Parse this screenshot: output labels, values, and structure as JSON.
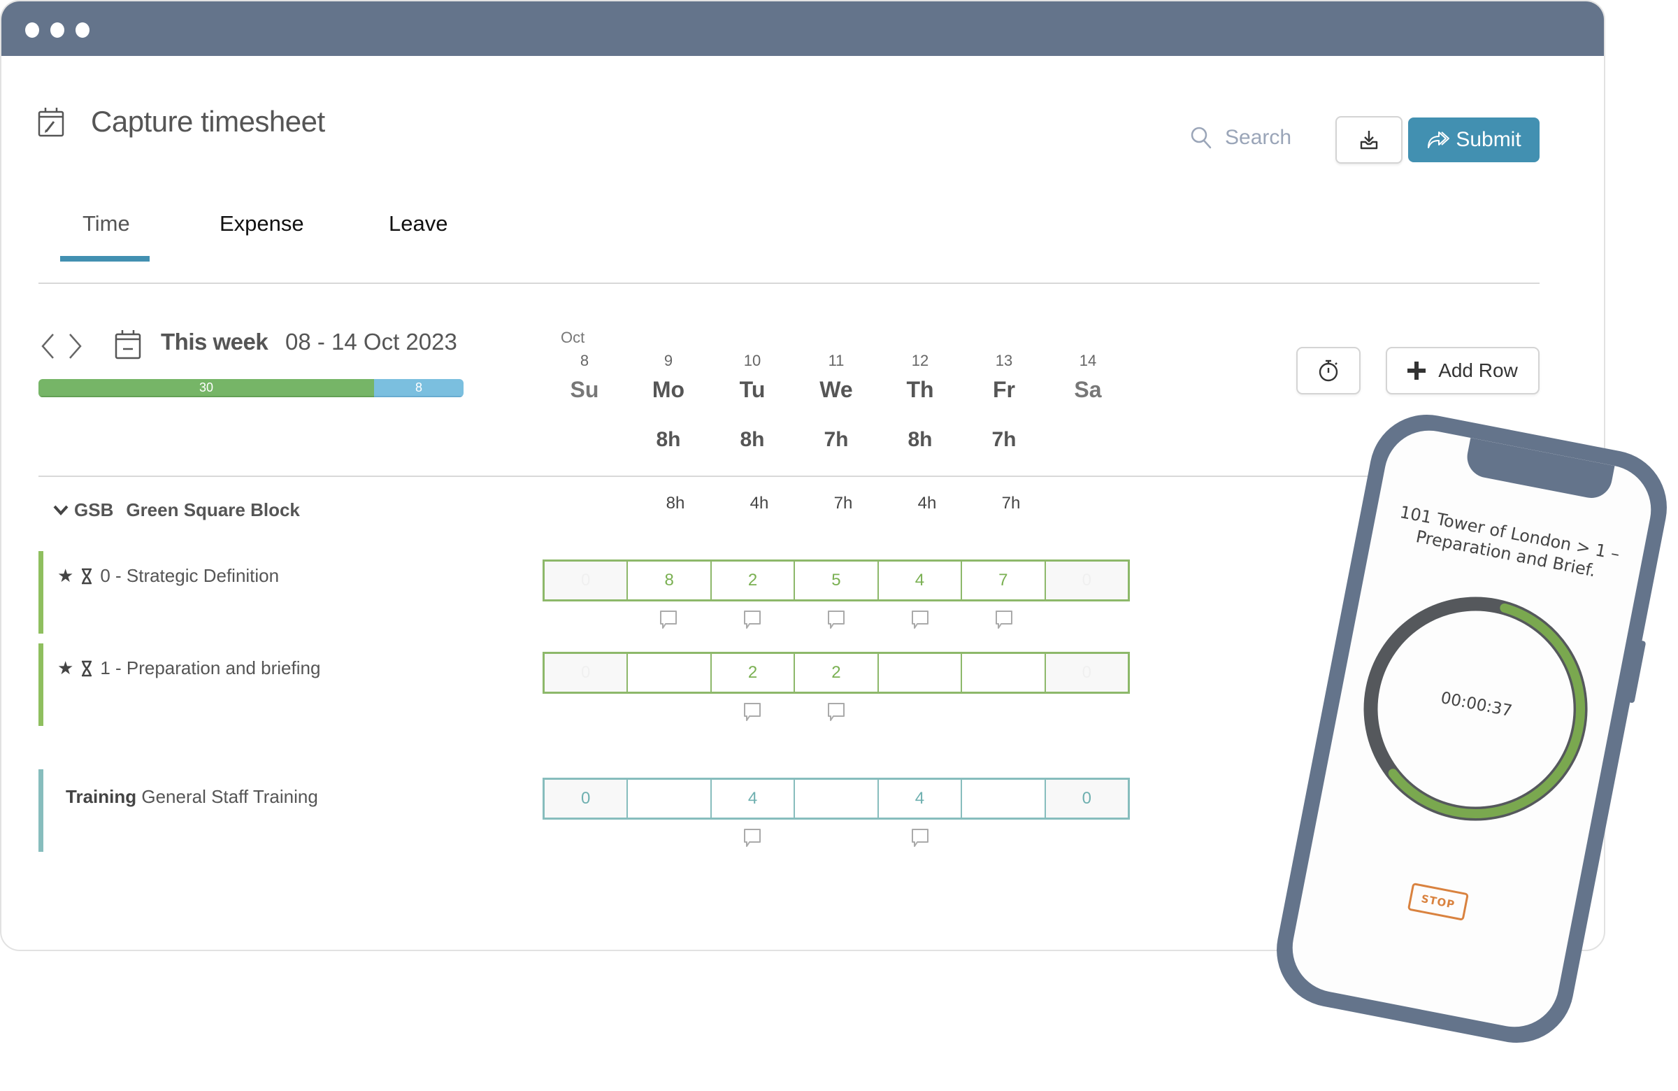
{
  "window": {
    "controls": [
      "close",
      "minimize",
      "maximize"
    ]
  },
  "header": {
    "title": "Capture timesheet",
    "title_icon": "calendar-edit-icon",
    "search_placeholder": "Search",
    "download_icon": "download-icon",
    "submit_label": "Submit",
    "submit_icon": "share-forward-icon"
  },
  "tabs": [
    {
      "label": "Time",
      "active": true
    },
    {
      "label": "Expense",
      "active": false
    },
    {
      "label": "Leave",
      "active": false
    }
  ],
  "week": {
    "label": "This week",
    "range": "08 - 14 Oct 2023",
    "month": "Oct",
    "hours_summary": {
      "green_value": "30",
      "blue_value": "8",
      "green_hours": 30,
      "blue_hours": 8
    }
  },
  "days": [
    {
      "num": "8",
      "name": "Su",
      "total": "",
      "group_total": "",
      "weekend": true
    },
    {
      "num": "9",
      "name": "Mo",
      "total": "8h",
      "group_total": "8h",
      "weekend": false
    },
    {
      "num": "10",
      "name": "Tu",
      "total": "8h",
      "group_total": "4h",
      "weekend": false
    },
    {
      "num": "11",
      "name": "We",
      "total": "7h",
      "group_total": "7h",
      "weekend": false
    },
    {
      "num": "12",
      "name": "Th",
      "total": "8h",
      "group_total": "4h",
      "weekend": false
    },
    {
      "num": "13",
      "name": "Fr",
      "total": "7h",
      "group_total": "7h",
      "weekend": false
    },
    {
      "num": "14",
      "name": "Sa",
      "total": "",
      "group_total": "",
      "weekend": true
    }
  ],
  "toolbar": {
    "add_row_label": "Add Row",
    "timer_icon": "stopwatch-icon",
    "add_icon": "plus-icon"
  },
  "group": {
    "code": "GSB",
    "name": "Green Square Block",
    "expanded": true
  },
  "rows": [
    {
      "label": "0 - Strategic Definition",
      "starred": true,
      "timed": true,
      "accent": "#8fbf5f",
      "cells": [
        "0",
        "8",
        "2",
        "5",
        "4",
        "7",
        "0"
      ],
      "comments": [
        false,
        true,
        true,
        true,
        true,
        true,
        false
      ]
    },
    {
      "label": "1 - Preparation and briefing",
      "starred": true,
      "timed": true,
      "accent": "#8fbf5f",
      "cells": [
        "0",
        "",
        "2",
        "2",
        "",
        "",
        "0"
      ],
      "comments": [
        false,
        false,
        true,
        true,
        false,
        false,
        false
      ]
    },
    {
      "code": "Training",
      "label": "General Staff Training",
      "accent": "#87bdbd",
      "cells": [
        "0",
        "",
        "4",
        "",
        "4",
        "",
        "0"
      ],
      "comments": [
        false,
        false,
        true,
        false,
        true,
        false,
        false
      ]
    }
  ],
  "phone": {
    "task_line1": "101 Tower of London > 1 –",
    "task_line2": "Preparation and Brief.",
    "elapsed": "00:00:37",
    "ring_progress": 0.6,
    "stop_label": "STOP"
  },
  "colors": {
    "titlebar": "#64748b",
    "accent_blue": "#4290b1",
    "green": "#76b567",
    "light_blue": "#7bbfdf",
    "teal": "#87bdbd",
    "stop_orange": "#d9823f"
  }
}
